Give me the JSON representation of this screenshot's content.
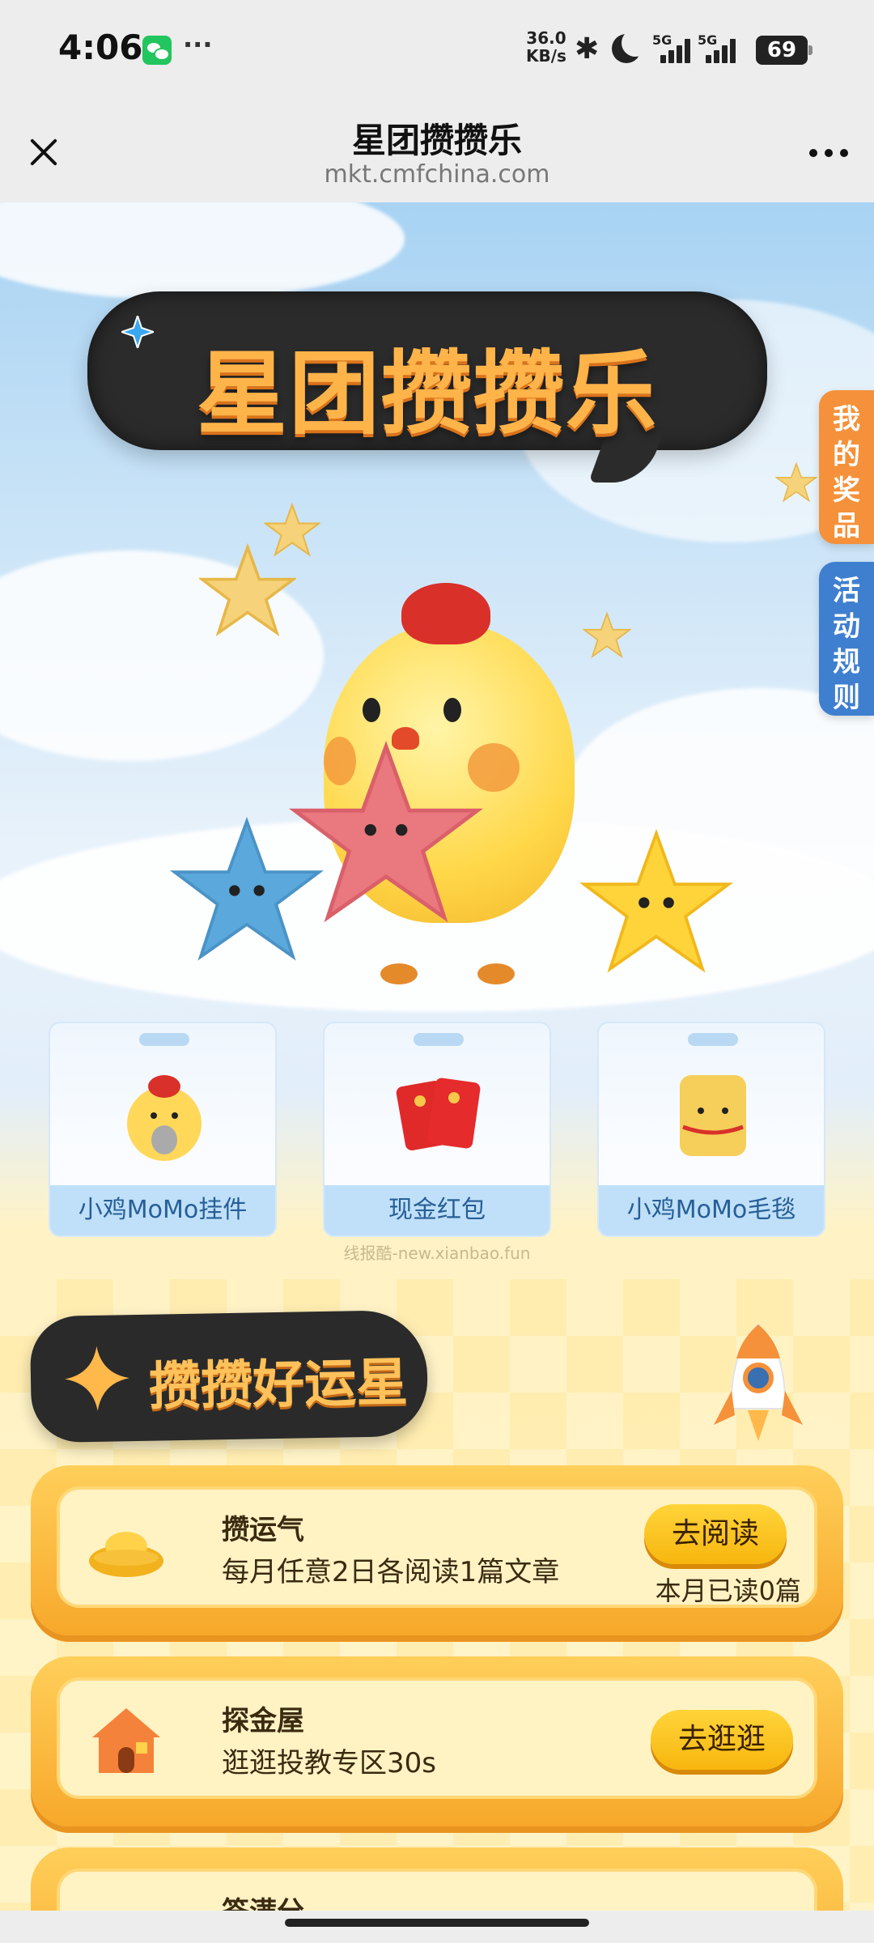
{
  "status_bar": {
    "time": "4:06",
    "dots": "···",
    "net_speed_value": "36.0",
    "net_speed_unit": "KB/s",
    "signal_1_label": "5G",
    "signal_2_label": "5G",
    "battery": "69"
  },
  "title_bar": {
    "title": "星团攒攒乐",
    "url": "mkt.cmfchina.com"
  },
  "hero": {
    "title": "星团攒攒乐"
  },
  "side_tabs": {
    "my_prizes": "我的奖品",
    "rules": "活动规则"
  },
  "prizes": [
    {
      "label": "小鸡MoMo挂件"
    },
    {
      "label": "现金红包"
    },
    {
      "label": "小鸡MoMo毛毯"
    }
  ],
  "watermark": "线报酷-new.xianbao.fun",
  "section": {
    "title": "攒攒好运星"
  },
  "tasks": [
    {
      "title": "攒运气",
      "desc": "每月任意2日各阅读1篇文章",
      "button": "去阅读",
      "progress": "本月已读0篇"
    },
    {
      "title": "探金屋",
      "desc": "逛逛投教专区30s",
      "button": "去逛逛"
    },
    {
      "title": "签满分"
    }
  ],
  "colors": {
    "accent_orange": "#f7a82a",
    "side_tab_prizes": "#f5913a",
    "side_tab_rules": "#3f7fd0",
    "prize_label_bg": "#bfe0f8"
  }
}
